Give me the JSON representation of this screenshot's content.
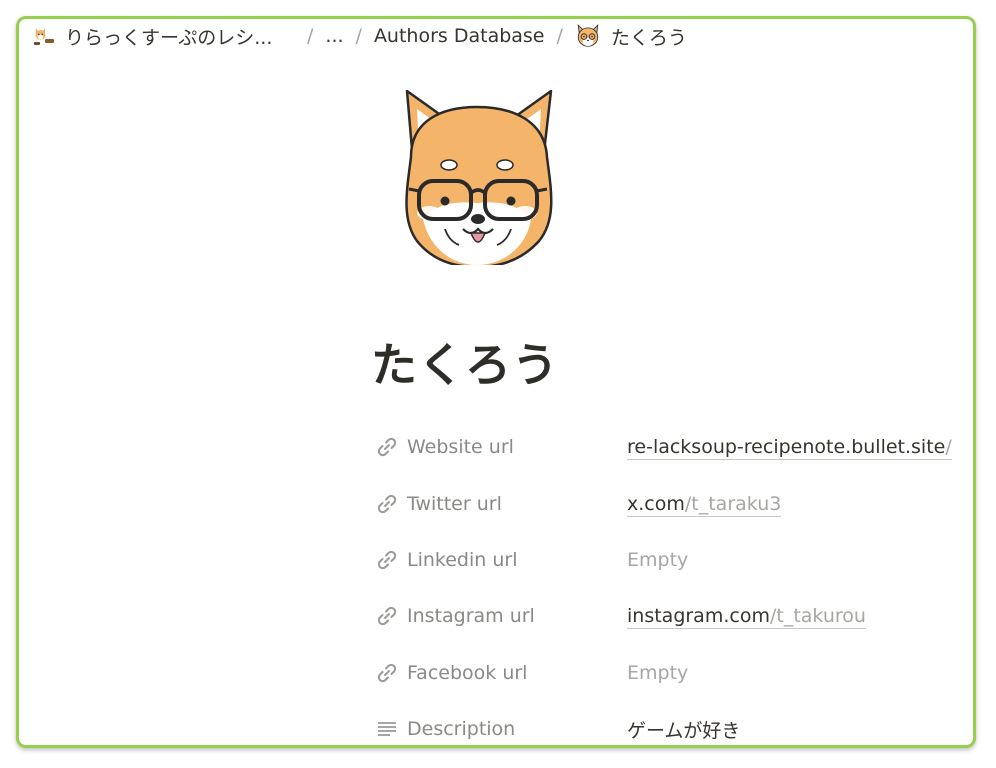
{
  "breadcrumb": {
    "items": [
      {
        "label": "りらっくすーぷのレシ...",
        "icon": "shiba-recipe-icon"
      },
      {
        "label": "..."
      },
      {
        "label": "Authors Database"
      },
      {
        "label": "たくろう",
        "icon": "shiba-glasses-icon"
      }
    ],
    "separator": "/"
  },
  "page": {
    "title": "たくろう",
    "avatar_icon": "shiba-glasses-avatar"
  },
  "properties": {
    "website": {
      "name": "Website url",
      "icon": "link-icon",
      "domain": "re-lacksoup-recipenote.bullet.site",
      "path": "/"
    },
    "twitter": {
      "name": "Twitter url",
      "icon": "link-icon",
      "domain": "x.com",
      "path": "/t_taraku3"
    },
    "linkedin": {
      "name": "Linkedin url",
      "icon": "link-icon",
      "empty": "Empty"
    },
    "instagram": {
      "name": "Instagram url",
      "icon": "link-icon",
      "domain": "instagram.com",
      "path": "/t_takurou"
    },
    "facebook": {
      "name": "Facebook url",
      "icon": "link-icon",
      "empty": "Empty"
    },
    "description": {
      "name": "Description",
      "icon": "text-lines-icon",
      "value": "ゲームが好き"
    }
  },
  "colors": {
    "frame_border": "#97cf4f",
    "shiba_fur": "#f4b469",
    "text_primary": "#37352f",
    "text_muted": "#8a8985"
  }
}
